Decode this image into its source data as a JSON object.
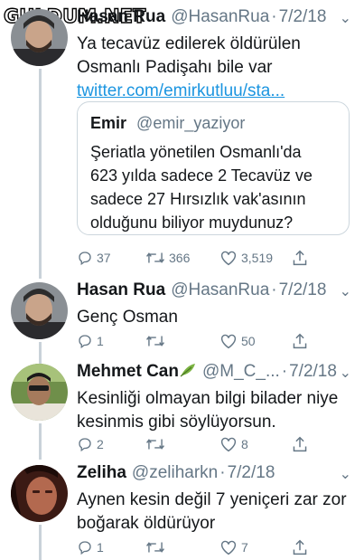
{
  "watermark": "GULDUM.NET",
  "tweets": [
    {
      "name": "Hasan Rua",
      "handle": "@HasanRua",
      "date": "7/2/18",
      "text_lines": [
        "Ya tecavüz edilerek öldürülen",
        "Osmanlı Padişahı bile var"
      ],
      "link": "twitter.com/emirkutluu/sta...",
      "quote": {
        "name": "Emir",
        "handle": "@emir_yaziyor",
        "text_lines": [
          "Şeriatla yönetilen Osmanlı'da",
          "623 yılda sadece 2 Tecavüz ve",
          "sadece 27 Hırsızlık vak'asının",
          "olduğunu biliyor muydunuz?"
        ]
      },
      "replies": "37",
      "retweets": "366",
      "likes": "3,519"
    },
    {
      "name": "Hasan Rua",
      "handle": "@HasanRua",
      "date": "7/2/18",
      "text_lines": [
        "Genç Osman"
      ],
      "replies": "1",
      "retweets": "",
      "likes": "50"
    },
    {
      "name": "Mehmet Can",
      "handle": "@M_C_...",
      "date": "7/2/18",
      "text_lines": [
        "Kesinliği olmayan bilgi bilader niye",
        "kesinmis gibi söylüyorsun."
      ],
      "replies": "2",
      "retweets": "",
      "likes": "8"
    },
    {
      "name": "Zeliha",
      "handle": "@zeliharkn",
      "date": "7/2/18",
      "text_lines": [
        "Aynen kesin değil 7 yeniçeri zar zor",
        "boğarak öldürüyor"
      ],
      "replies": "1",
      "retweets": "",
      "likes": "7"
    }
  ],
  "colors": {
    "link": "#1b95e0",
    "muted": "#657786",
    "thread_line": "#c9d2d9",
    "border": "#ccd6dd"
  },
  "icons": [
    "reply-icon",
    "retweet-icon",
    "like-icon",
    "share-icon",
    "chevron-down-icon",
    "leaf-emoji-icon"
  ]
}
